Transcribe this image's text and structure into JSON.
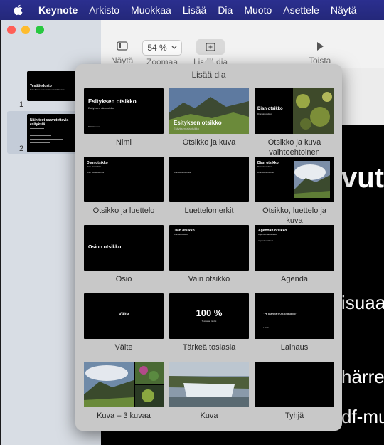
{
  "menubar": {
    "items": [
      "Keynote",
      "Arkisto",
      "Muokkaa",
      "Lisää",
      "Dia",
      "Muoto",
      "Asettele",
      "Näytä"
    ]
  },
  "toolbar": {
    "view_label": "Näytä",
    "zoom_value": "54 %",
    "zoom_label": "Zoomaa",
    "add_slide_label": "Lisää dia",
    "play_label": "Toista"
  },
  "sidebar": {
    "slides": [
      {
        "number": "1",
        "title": "Testitiedosto",
        "subtitle": "Kokeillaan saavutettavuustarkistusta"
      },
      {
        "number": "2",
        "title": "Näin teet saavutettavia esityksiä"
      }
    ]
  },
  "background_words": [
    "vuto",
    "isuaa",
    "härret",
    "df-mu"
  ],
  "popover": {
    "title": "Lisää dia",
    "layouts": [
      {
        "name": "Nimi",
        "title": "Esityksen otsikko",
        "subtitle": "Esityksen alaotsikko",
        "extra": "Tekijän nimi"
      },
      {
        "name": "Otsikko ja kuva",
        "title": "Esityksen otsikko",
        "subtitle": "Esityksen alaotsikko"
      },
      {
        "name": "Otsikko ja kuva vaihtoehtoinen",
        "title": "Dian otsikko",
        "subtitle": "Dian alaotsikko"
      },
      {
        "name": "Otsikko ja luettelo",
        "title": "Dian otsikko",
        "subtitle": "Dian alaotsikko",
        "extra": "Dian luettelokohta"
      },
      {
        "name": "Luettelomerkit",
        "extra": "Dian luettelokohta"
      },
      {
        "name": "Otsikko, luettelo ja kuva",
        "title": "Dian otsikko",
        "subtitle": "Dian alaotsikko",
        "extra": "Dian luettelokohta"
      },
      {
        "name": "Osio",
        "title": "Osion otsikko"
      },
      {
        "name": "Vain otsikko",
        "title": "Dian otsikko",
        "subtitle": "Dian alaotsikko"
      },
      {
        "name": "Agenda",
        "title": "Agendan otsikko",
        "subtitle": "Agendan alaotsikko",
        "extra": "Agendan aiheet"
      },
      {
        "name": "Väite",
        "title": "Väite"
      },
      {
        "name": "Tärkeä tosiasia",
        "title": "100 %",
        "subtitle": "Tosiasian tiedot"
      },
      {
        "name": "Lainaus",
        "title": "“Huomattava lainaus”",
        "subtitle": "Lähde"
      },
      {
        "name": "Kuva – 3 kuvaa"
      },
      {
        "name": "Kuva"
      },
      {
        "name": "Tyhjä"
      }
    ]
  },
  "colors": {
    "menubar": "#2b2f8f",
    "close": "#ff5f57",
    "minimize": "#febc2e",
    "zoom": "#28c840"
  }
}
